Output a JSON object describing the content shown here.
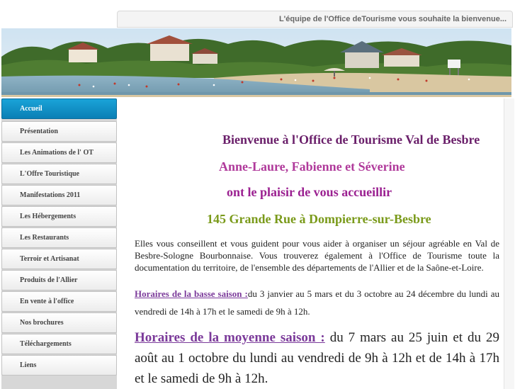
{
  "header": {
    "tagline": "L'équipe de l'Office deTourisme vous souhaite la bienvenue..."
  },
  "sidebar": {
    "items": [
      {
        "label": "Accueil",
        "active": true
      },
      {
        "label": "Présentation"
      },
      {
        "label": "Les Animations de l' OT"
      },
      {
        "label": "L'Offre Touristique"
      },
      {
        "label": "Manifestations 2011"
      },
      {
        "label": "Les Hébergements"
      },
      {
        "label": "Les Restaurants"
      },
      {
        "label": "Terroir et Artisanat"
      },
      {
        "label": "Produits de l'Allier"
      },
      {
        "label": "En vente à l'office"
      },
      {
        "label": "Nos brochures"
      },
      {
        "label": "Téléchargements"
      },
      {
        "label": "Liens"
      }
    ]
  },
  "main": {
    "title": "Bienvenue à l'Office de Tourisme Val de Besbre",
    "staff": "Anne-Laure, Fabienne et Séverine",
    "welcome": "ont le plaisir de vous accueillir",
    "address": "145 Grande Rue à Dompierre-sur-Besbre",
    "intro": "Elles vous conseillent et vous guident pour vous aider à organiser un séjour agréable en Val de Besbre-Sologne Bourbonnaise. Vous trouverez également à l'Office de Tourisme toute la documentation du territoire, de l'ensemble des départements de l'Allier et de la Saône-et-Loire.",
    "low_season_link": "Horaires de la basse saison :",
    "low_season_text": "du 3 janvier au 5 mars et du 3 octobre au 24 décembre du lundi au vendredi de 14h à 17h et le samedi de 9h à 12h.",
    "mid_season_link": "Horaires de la moyenne saison :",
    "mid_season_text": " du 7 mars au 25 juin et du 29 août au 1 octobre du lundi au vendredi de 9h à 12h et de 14h à 17h et le samedi de 9h à 12h."
  },
  "colors": {
    "title": "#6a1f6a",
    "staff": "#b03a9b",
    "welcome": "#9b2191",
    "address": "#7a9a1a",
    "link": "#7b3a9a",
    "active_nav": "#1aa3d8"
  },
  "icons": {
    "banner": "lake-beach-photo"
  }
}
